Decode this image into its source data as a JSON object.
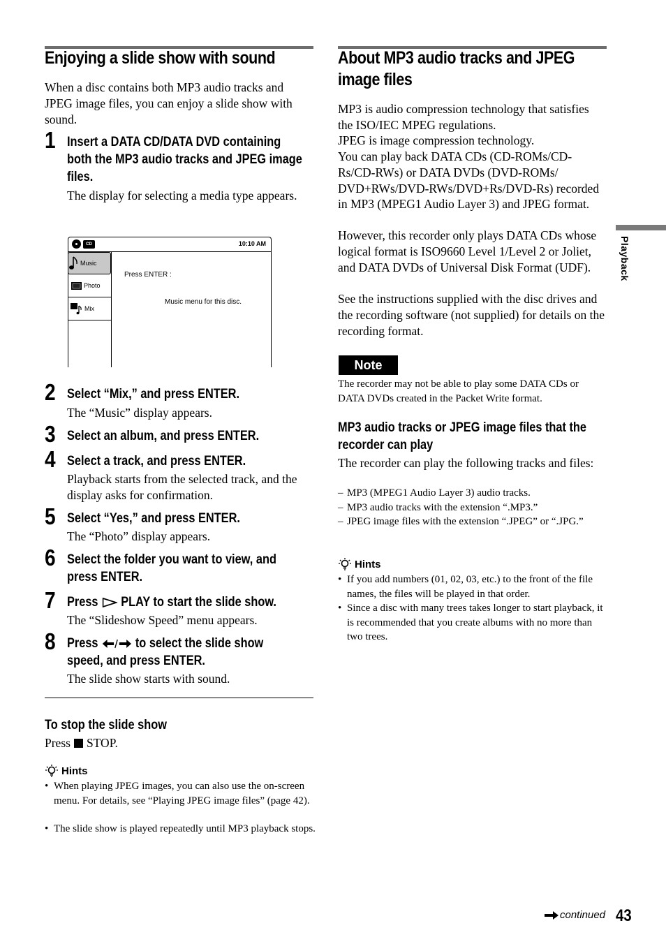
{
  "left": {
    "title": "Enjoying a slide show with sound",
    "intro": "When a disc contains both MP3 audio tracks and JPEG image files, you can enjoy a slide show with sound.",
    "steps": [
      {
        "num": "1",
        "title_lines": [
          "Insert a DATA CD/DATA DVD containing",
          "both the MP3 audio tracks and JPEG image",
          "files."
        ],
        "desc": "The display for selecting a media type appears."
      },
      {
        "num": "2",
        "title_lines": [
          "Select “Mix,” and press ENTER."
        ],
        "desc": "The “Music” display appears."
      },
      {
        "num": "3",
        "title_lines": [
          "Select an album, and press ENTER."
        ],
        "desc": ""
      },
      {
        "num": "4",
        "title_lines": [
          "Select a track, and press ENTER."
        ],
        "desc": "Playback starts from the selected track, and the display asks for confirmation."
      },
      {
        "num": "5",
        "title_lines": [
          "Select “Yes,” and press ENTER."
        ],
        "desc": "The “Photo” display appears."
      },
      {
        "num": "6",
        "title_lines": [
          "Select the folder you want to view, and",
          "press ENTER."
        ],
        "desc": ""
      },
      {
        "num": "7",
        "title_pre": "Press",
        "title_icon": "play-icon",
        "title_post": "PLAY to start the slide show.",
        "desc": "The “Slideshow Speed” menu appears."
      },
      {
        "num": "8",
        "title_pre": "Press",
        "title_icon": "left-right-arrows-icon",
        "title_post": "to select the slide show",
        "title_line2": "speed, and press ENTER.",
        "desc": "The slide show starts with sound."
      }
    ],
    "screen": {
      "disc_label": "CD",
      "time": "10:10 AM",
      "menu": [
        {
          "icon": "music-note-icon",
          "label": "Music",
          "selected": true
        },
        {
          "icon": "photo-icon",
          "label": "Photo",
          "selected": false
        },
        {
          "icon": "mix-icon",
          "label": "Mix",
          "selected": false
        }
      ],
      "prompt": "Press ENTER :",
      "message": "Music menu for this disc."
    },
    "stop": {
      "heading": "To stop the slide show",
      "text_pre": "Press",
      "text_icon": "stop-icon",
      "text_post": "STOP."
    },
    "hints": {
      "heading": "Hints",
      "items": [
        "When playing JPEG images, you can also use the on-screen menu. For details, see “Playing JPEG image files” (page 42).",
        "The slide show is played repeatedly until MP3 playback stops."
      ]
    }
  },
  "right": {
    "title_lines": [
      "About MP3 audio tracks and JPEG",
      "image files"
    ],
    "paragraphs": [
      "MP3 is audio compression technology that satisfies the ISO/IEC MPEG regulations.",
      "JPEG is image compression technology.",
      "You can play back DATA CDs (CD-ROMs/CD-Rs/CD-RWs) or DATA DVDs (DVD-ROMs/ DVD+RWs/DVD-RWs/DVD+Rs/DVD-Rs) recorded in MP3 (MPEG1 Audio Layer 3) and JPEG format.",
      "However, this recorder only plays DATA CDs whose logical format is ISO9660 Level 1/Level 2 or Joliet, and DATA DVDs of Universal Disk Format (UDF).",
      "See the instructions supplied with the disc drives and the recording software (not supplied) for details on the recording format."
    ],
    "note": {
      "label": "Note",
      "text": "The recorder may not be able to play some DATA CDs or DATA DVDs created in the Packet Write format."
    },
    "playable": {
      "heading_lines": [
        "MP3 audio tracks or JPEG image files that the",
        "recorder can play"
      ],
      "intro": "The recorder can play the following tracks and files:",
      "items": [
        "MP3 (MPEG1 Audio Layer 3) audio tracks.",
        "MP3 audio tracks with the extension “.MP3.”",
        "JPEG image files with the extension “.JPEG” or “.JPG.”"
      ]
    },
    "hints": {
      "heading": "Hints",
      "items": [
        "If you add numbers (01, 02, 03, etc.) to the front of the file names, the files will be played in that order.",
        "Since a disc with many trees takes longer to start playback, it is recommended that you create albums with no more than two trees."
      ]
    }
  },
  "side_tab": {
    "label": "Playback"
  },
  "footer": {
    "continued": "continued",
    "page_number": "43"
  }
}
